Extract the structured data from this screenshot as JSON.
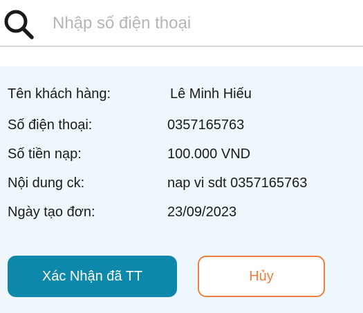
{
  "search": {
    "placeholder": "Nhập số điện thoại",
    "value": "",
    "icon": "search-icon"
  },
  "details": {
    "rows": [
      {
        "label": "Tên khách hàng:",
        "value": "Lê Minh Hiếu"
      },
      {
        "label": "Số điện thoại:",
        "value": "0357165763"
      },
      {
        "label": "Số tiền nạp:",
        "value": "100.000 VND"
      },
      {
        "label": "Nội dung ck:",
        "value": "nap vi sdt 0357165763"
      },
      {
        "label": "Ngày tạo đơn:",
        "value": "23/09/2023"
      }
    ]
  },
  "actions": {
    "confirm_label": "Xác Nhận đã TT",
    "cancel_label": "Hủy"
  },
  "colors": {
    "panel_background": "#eef8fc",
    "confirm_button": "#0e88aa",
    "cancel_accent": "#f07d3b",
    "divider": "#d9d9d9"
  }
}
